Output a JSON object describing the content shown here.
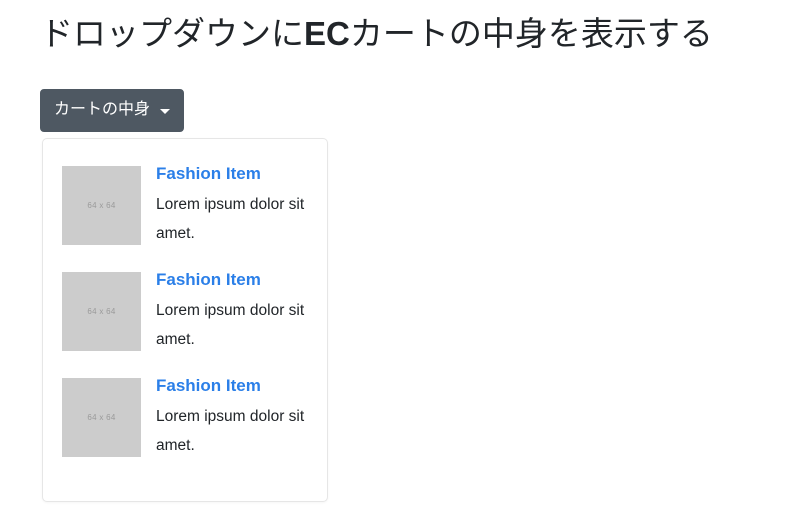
{
  "page": {
    "title_prefix": "ドロップダウンに",
    "title_emphasis": "EC",
    "title_suffix": "カートの中身を表示する",
    "title_full": "ドロップダウンにECカートの中身を表示する"
  },
  "dropdown": {
    "toggle_label": "カートの中身",
    "caret_icon": "chevron-down-icon",
    "expanded": "true",
    "items": [
      {
        "thumb_label": "64 x 64",
        "title": "Fashion Item",
        "description": "Lorem ipsum dolor sit amet."
      },
      {
        "thumb_label": "64 x 64",
        "title": "Fashion Item",
        "description": "Lorem ipsum dolor sit amet."
      },
      {
        "thumb_label": "64 x 64",
        "title": "Fashion Item",
        "description": "Lorem ipsum dolor sit amet."
      }
    ]
  },
  "colors": {
    "toggle_background": "#4e5862",
    "toggle_text": "#ffffff",
    "item_title": "#2b7fe8",
    "thumb_background": "#cccccc",
    "thumb_text": "#9a9a9a",
    "panel_border": "#e6e6e6",
    "page_background": "#ffffff",
    "body_text": "#212529"
  }
}
